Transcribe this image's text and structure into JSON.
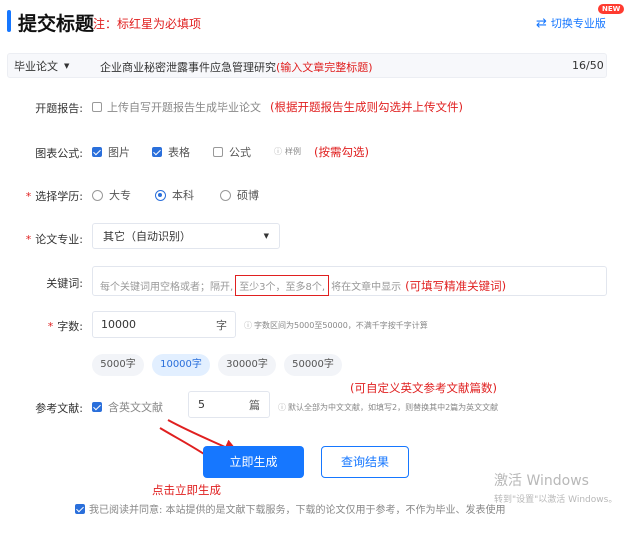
{
  "header": {
    "title": "提交标题",
    "note": "注：标红星为必填项",
    "switch_label": "切换专业版",
    "new_badge": "NEW"
  },
  "title_row": {
    "type_select": "毕业论文",
    "title_value": "企业商业秘密泄露事件应急管理研究",
    "annotation": "(输入文章完整标题)",
    "counter": "16/50"
  },
  "proposal": {
    "label": "开题报告:",
    "option": "上传自写开题报告生成毕业论文",
    "annotation": "(根据开题报告生成则勾选并上传文件)"
  },
  "figures": {
    "label": "图表公式:",
    "options": [
      {
        "label": "图片",
        "checked": true
      },
      {
        "label": "表格",
        "checked": true
      },
      {
        "label": "公式",
        "checked": false
      }
    ],
    "example": "样例",
    "annotation": "(按需勾选)"
  },
  "degree": {
    "label": "选择学历:",
    "options": [
      {
        "label": "大专",
        "selected": false
      },
      {
        "label": "本科",
        "selected": true
      },
      {
        "label": "硕博",
        "selected": false
      }
    ]
  },
  "major": {
    "label": "论文专业:",
    "value": "其它（自动识别）"
  },
  "keywords": {
    "label": "关键词:",
    "placeholder_a": "每个关键词用空格或者；隔开,",
    "placeholder_b": "至少3个，至多8个,",
    "placeholder_c": "将在文章中显示",
    "annotation": "(可填写精准关键词)"
  },
  "word_count": {
    "label": "字数:",
    "value": "10000",
    "unit": "字",
    "hint": "字数区间为5000至50000，不满千字按千字计算",
    "chips": [
      {
        "label": "5000字",
        "active": false
      },
      {
        "label": "10000字",
        "active": true
      },
      {
        "label": "30000字",
        "active": false
      },
      {
        "label": "50000字",
        "active": false
      }
    ],
    "annotation": "(可自定义英文参考文献篇数)"
  },
  "references": {
    "label": "参考文献:",
    "checkbox": "含英文文献",
    "value": "5",
    "unit": "篇",
    "hint": "默认全部为中文文献，如填写2，则替换其中2篇为英文文献"
  },
  "actions": {
    "generate": "立即生成",
    "query": "查询结果",
    "annotation": "点击立即生成"
  },
  "agreement": "我已阅读并同意: 本站提供的是文献下载服务，下载的论文仅用于参考，不作为毕业、发表使用",
  "watermark": {
    "line1": "激活 Windows",
    "line2": "转到\"设置\"以激活 Windows。"
  },
  "colors": {
    "accent": "#1677ff",
    "annotation_red": "#e02020"
  }
}
